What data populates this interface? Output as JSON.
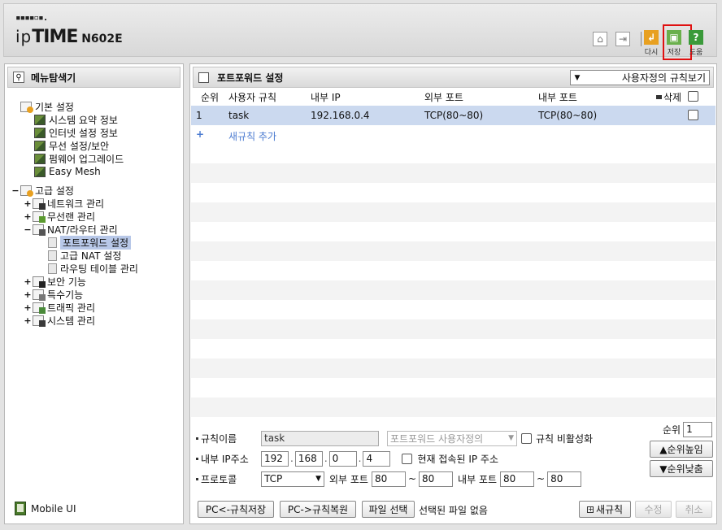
{
  "header": {
    "logo_dots": "▪▪▪▪▫▪.",
    "logo_ip": "ip",
    "logo_time": "TIME",
    "model": "N602E",
    "toolbar": {
      "home_icon": "home-icon",
      "logout_icon": "logout-icon",
      "reload_label": "다시",
      "save_label": "저장",
      "help_label": "도움"
    }
  },
  "sidebar": {
    "title": "메뉴탐색기",
    "tree": {
      "basic": {
        "label": "기본 설정",
        "items": [
          "시스템 요약 정보",
          "인터넷 설정 정보",
          "무선 설정/보안",
          "펌웨어 업그레이드",
          "Easy Mesh"
        ]
      },
      "advanced": {
        "label": "고급 설정",
        "toggle": "−",
        "network": "네트워크 관리",
        "wireless": "무선랜 관리",
        "nat": {
          "label": "NAT/라우터 관리",
          "items": [
            "포트포워드 설정",
            "고급 NAT 설정",
            "라우팅 테이블 관리"
          ]
        },
        "security": "보안 기능",
        "special": "특수기능",
        "traffic": "트래픽 관리",
        "system": "시스템 관리"
      },
      "expand_symbol": "+",
      "collapse_symbol": "−"
    },
    "mobile_ui": "Mobile UI"
  },
  "main": {
    "title": "포트포워드 설정",
    "view_select": "사용자정의 규칙보기",
    "columns": {
      "order": "순위",
      "rule": "사용자 규칙",
      "internal_ip": "내부 IP",
      "external_port": "외부 포트",
      "internal_port": "내부 포트",
      "delete": "삭제"
    },
    "rows": [
      {
        "order": "1",
        "rule": "task",
        "internal_ip": "192.168.0.4",
        "external_port": "TCP(80~80)",
        "internal_port": "TCP(80~80)"
      }
    ],
    "add_rule_plus": "+",
    "add_rule": "새규칙 추가",
    "form": {
      "rule_name_label": "규칙이름",
      "rule_name_value": "task",
      "rule_type_select": "포트포워드 사용자정의",
      "disable_rule_label": "규칙 비활성화",
      "internal_ip_label": "내부 IP주소",
      "ip_octets": [
        "192",
        "168",
        "0",
        "4"
      ],
      "current_ip_label": "현재 접속된 IP 주소",
      "protocol_label": "프로토콜",
      "protocol_value": "TCP",
      "external_port_label": "외부 포트",
      "external_port_from": "80",
      "external_port_to": "80",
      "internal_port_label": "내부 포트",
      "internal_port_from": "80",
      "internal_port_to": "80",
      "tilde": "~",
      "priority_label": "순위",
      "priority_value": "1",
      "priority_up": "▲순위높임",
      "priority_down": "▼순위낮춤"
    },
    "buttons": {
      "pc_save": "PC<-규칙저장",
      "pc_restore": "PC->규칙복원",
      "file_select": "파일 선택",
      "file_status": "선택된 파일 없음",
      "new_rule": "새규칙",
      "modify": "수정",
      "cancel": "취소"
    }
  },
  "colors": {
    "selected_row": "#cbd9ef",
    "highlight_border": "#e01010",
    "reload_icon": "#e8a020",
    "save_icon": "#6ab04c",
    "help_icon": "#3a9a3a"
  }
}
